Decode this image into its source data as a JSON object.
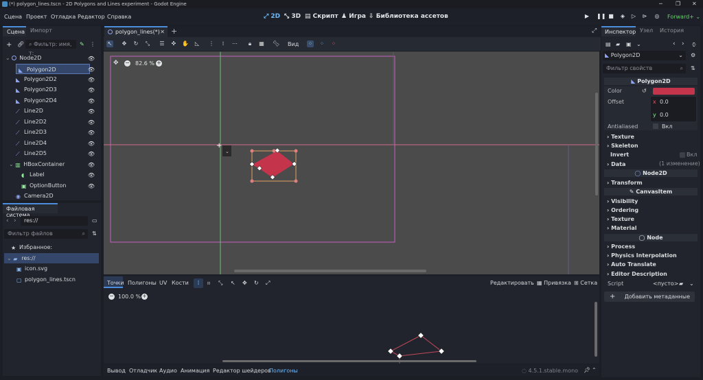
{
  "title_bar": {
    "title": "(*) polygon_lines.tscn - 2D Polygons and Lines experiment - Godot Engine"
  },
  "menu": [
    "Сцена",
    "Проект",
    "Отладка",
    "Редактор",
    "Справка"
  ],
  "modes": [
    {
      "label": "2D",
      "icon": "2d-icon",
      "active": true
    },
    {
      "label": "3D",
      "icon": "3d-icon",
      "active": false
    },
    {
      "label": "Скрипт",
      "icon": "script-icon",
      "active": false
    },
    {
      "label": "Игра",
      "icon": "game-icon",
      "active": false
    },
    {
      "label": "Библиотека ассетов",
      "icon": "assetlib-icon",
      "active": false
    }
  ],
  "renderer": "Forward+",
  "scene_dock": {
    "tabs": [
      "Сцена",
      "Импорт"
    ],
    "filter_placeholder": "Фильтр: имя, т:",
    "nodes": [
      {
        "name": "Node2D",
        "icon": "node2d-icon",
        "depth": 0,
        "color": "#a5b7f3",
        "eye": true
      },
      {
        "name": "Polygon2D",
        "icon": "polygon2d-icon",
        "depth": 1,
        "color": "#8da5f3",
        "eye": true,
        "selected": true
      },
      {
        "name": "Polygon2D2",
        "icon": "polygon2d-icon",
        "depth": 1,
        "color": "#8da5f3",
        "eye": true
      },
      {
        "name": "Polygon2D3",
        "icon": "polygon2d-icon",
        "depth": 1,
        "color": "#8da5f3",
        "eye": true
      },
      {
        "name": "Polygon2D4",
        "icon": "polygon2d-icon",
        "depth": 1,
        "color": "#8da5f3",
        "eye": true
      },
      {
        "name": "Line2D",
        "icon": "line2d-icon",
        "depth": 1,
        "color": "#8da5f3",
        "eye": true
      },
      {
        "name": "Line2D2",
        "icon": "line2d-icon",
        "depth": 1,
        "color": "#8da5f3",
        "eye": true
      },
      {
        "name": "Line2D3",
        "icon": "line2d-icon",
        "depth": 1,
        "color": "#8da5f3",
        "eye": true
      },
      {
        "name": "Line2D4",
        "icon": "line2d-icon",
        "depth": 1,
        "color": "#8da5f3",
        "eye": true
      },
      {
        "name": "Line2D5",
        "icon": "line2d-icon",
        "depth": 1,
        "color": "#8da5f3",
        "eye": true
      },
      {
        "name": "HBoxContainer",
        "icon": "hbox-icon",
        "depth": 1,
        "color": "#8eef97",
        "eye": true
      },
      {
        "name": "Label",
        "icon": "label-icon",
        "depth": 2,
        "color": "#8eef97",
        "eye": true
      },
      {
        "name": "OptionButton",
        "icon": "optionbutton-icon",
        "depth": 2,
        "color": "#8eef97",
        "eye": true
      },
      {
        "name": "Camera2D",
        "icon": "camera2d-icon",
        "depth": 1,
        "color": "#8da5f3",
        "eye": false
      }
    ]
  },
  "filesystem_dock": {
    "tab": "Файловая система",
    "path": "res://",
    "filter_placeholder": "Фильтр файлов",
    "favorites": "Избранное:",
    "root": "res://",
    "files": [
      {
        "name": "icon.svg",
        "icon": "svg-file-icon"
      },
      {
        "name": "polygon_lines.tscn",
        "icon": "scene-file-icon"
      }
    ]
  },
  "editor_tabs": {
    "scene_tab": "polygon_lines(*)"
  },
  "toolbar": {
    "view_label": "Вид"
  },
  "viewport": {
    "zoom": "82.6 %"
  },
  "polygon_editor": {
    "tabs": [
      "Точки",
      "Полигоны",
      "UV",
      "Кости"
    ],
    "edit_label": "Редактировать",
    "snap_label": "Привязка",
    "grid_label": "Сетка",
    "zoom": "100.0 %"
  },
  "bottom_bar": {
    "tabs": [
      "Вывод",
      "Отладчик",
      "Аудио",
      "Анимация",
      "Редактор шейдеров",
      "Полигоны"
    ],
    "active_tab": "Полигоны",
    "version": "4.5.1.stable.mono"
  },
  "inspector": {
    "tabs": [
      "Инспектор",
      "Узел",
      "История"
    ],
    "node_name": "Polygon2D",
    "filter_placeholder": "Фильтр свойств",
    "class_header": "Polygon2D",
    "color_label": "Color",
    "color_value": "#c4354c",
    "offset_label": "Offset",
    "offset_x": "0.0",
    "offset_y": "0.0",
    "antialiased_label": "Antialiased",
    "on_label": "Вкл",
    "sections_polygon": [
      "Texture",
      "Skeleton"
    ],
    "invert_label": "Invert",
    "data_label": "Data",
    "data_changes": "(1 изменение)",
    "node2d_header": "Node2D",
    "transform_label": "Transform",
    "canvasitem_header": "CanvasItem",
    "sections_canvas": [
      "Visibility",
      "Ordering",
      "Texture",
      "Material"
    ],
    "node_header": "Node",
    "sections_node": [
      "Process",
      "Physics Interpolation",
      "Auto Translate",
      "Editor Description"
    ],
    "script_label": "Script",
    "script_value": "<пусто>",
    "add_metadata": "Добавить метаданные"
  }
}
